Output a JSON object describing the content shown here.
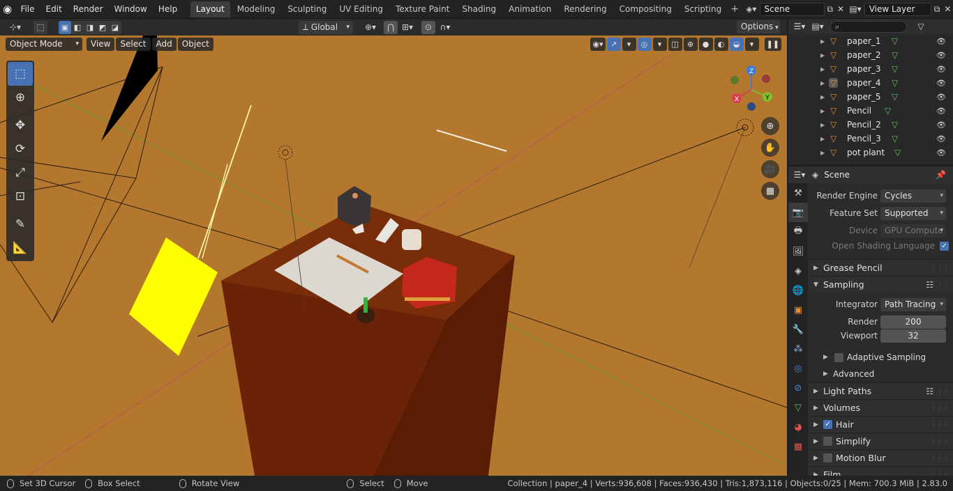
{
  "app_menu": [
    "File",
    "Edit",
    "Render",
    "Window",
    "Help"
  ],
  "workspaces": [
    {
      "label": "Layout",
      "active": true
    },
    {
      "label": "Modeling"
    },
    {
      "label": "Sculpting"
    },
    {
      "label": "UV Editing"
    },
    {
      "label": "Texture Paint"
    },
    {
      "label": "Shading"
    },
    {
      "label": "Animation"
    },
    {
      "label": "Rendering"
    },
    {
      "label": "Compositing"
    },
    {
      "label": "Scripting"
    }
  ],
  "scene_field": "Scene",
  "view_layer_field": "View Layer",
  "viewport_header": {
    "orientation": "Global",
    "options_label": "Options"
  },
  "viewport_menu": {
    "mode": "Object Mode",
    "view": "View",
    "select": "Select",
    "add": "Add",
    "object": "Object"
  },
  "gizmo_axes": {
    "z": "Z",
    "y": "Y",
    "x": "X"
  },
  "outliner": {
    "search_placeholder": "",
    "items": [
      {
        "name": "paper_1"
      },
      {
        "name": "paper_2"
      },
      {
        "name": "paper_3"
      },
      {
        "name": "paper_4",
        "selected": true
      },
      {
        "name": "paper_5"
      },
      {
        "name": "Pencil"
      },
      {
        "name": "Pencil_2"
      },
      {
        "name": "Pencil_3"
      },
      {
        "name": "pot plant"
      }
    ]
  },
  "properties": {
    "context_title": "Scene",
    "render_engine_label": "Render Engine",
    "render_engine_value": "Cycles",
    "feature_set_label": "Feature Set",
    "feature_set_value": "Supported",
    "device_label": "Device",
    "device_value": "GPU Compute",
    "osl_label": "Open Shading Language",
    "osl_checked": true,
    "panels": {
      "grease_pencil": "Grease Pencil",
      "sampling": "Sampling",
      "integrator_label": "Integrator",
      "integrator_value": "Path Tracing",
      "render_label": "Render",
      "render_value": "200",
      "viewport_label": "Viewport",
      "viewport_value": "32",
      "adaptive_sampling": "Adaptive Sampling",
      "advanced": "Advanced",
      "light_paths": "Light Paths",
      "volumes": "Volumes",
      "hair": "Hair",
      "simplify": "Simplify",
      "motion_blur": "Motion Blur",
      "film": "Film"
    }
  },
  "status_bar": {
    "set_cursor": "Set 3D Cursor",
    "box_select": "Box Select",
    "rotate_view": "Rotate View",
    "select": "Select",
    "move": "Move",
    "stats": "Collection | paper_4 | Verts:936,608 | Faces:936,430 | Tris:1,873,116 | Objects:0/25 | Mem: 700.3 MiB | 2.83.0"
  },
  "colors": {
    "accent": "#4772b3",
    "viewport_bg": "#b4772e",
    "object_icon": "#e3922e",
    "mesh_icon": "#62c264"
  }
}
